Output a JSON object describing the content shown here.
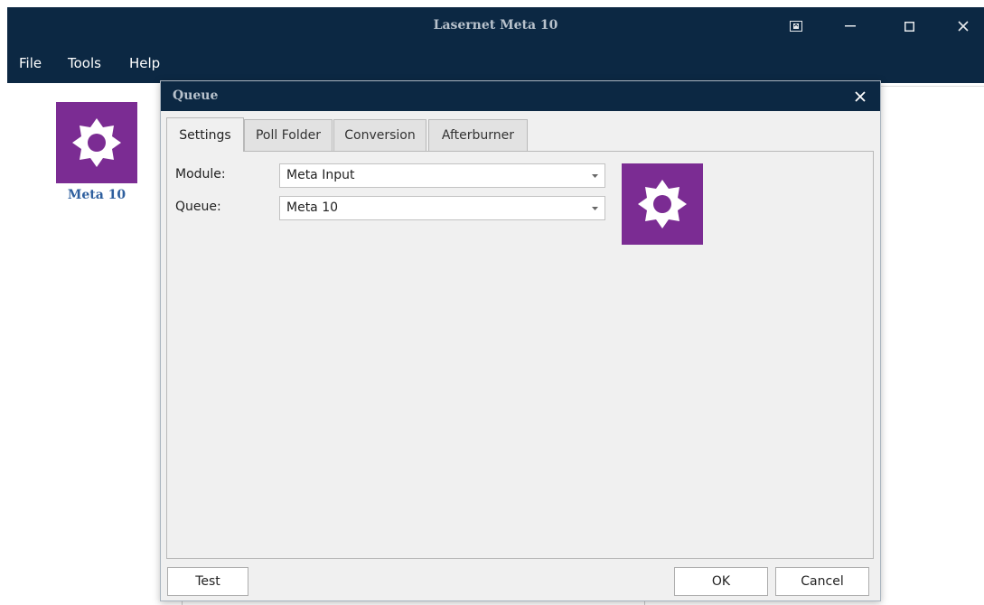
{
  "app": {
    "title": "Lasernet Meta 10",
    "menu": [
      "File",
      "Tools",
      "Help"
    ],
    "module_tile": {
      "label": "Meta 10",
      "icon": "gear-icon"
    }
  },
  "dialog": {
    "title": "Queue",
    "tabs": [
      {
        "label": "Settings",
        "active": true
      },
      {
        "label": "Poll Folder",
        "active": false
      },
      {
        "label": "Conversion",
        "active": false
      },
      {
        "label": "Afterburner",
        "active": false
      }
    ],
    "fields": {
      "module": {
        "label": "Module:",
        "value": "Meta Input"
      },
      "queue": {
        "label": "Queue:",
        "value": "Meta 10"
      }
    },
    "buttons": {
      "test": "Test",
      "ok": "OK",
      "cancel": "Cancel"
    }
  },
  "colors": {
    "titlebar": "#0c2843",
    "accent_tile": "#7b2c93",
    "link_blue": "#2e5f9e"
  }
}
